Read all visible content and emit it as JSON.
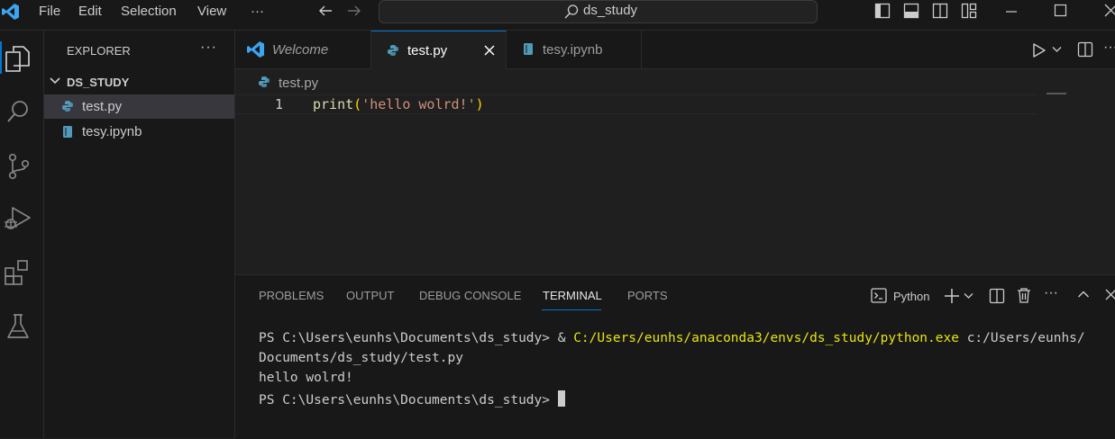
{
  "menu": [
    "File",
    "Edit",
    "Selection",
    "View",
    "···"
  ],
  "command_center": {
    "text": "ds_study"
  },
  "sidebar": {
    "title": "EXPLORER",
    "folder": "DS_STUDY",
    "files": [
      {
        "name": "test.py"
      },
      {
        "name": "tesy.ipynb"
      }
    ]
  },
  "tabs": [
    {
      "label": "Welcome"
    },
    {
      "label": "test.py"
    },
    {
      "label": "tesy.ipynb"
    }
  ],
  "breadcrumb": "test.py",
  "editor": {
    "line_number": "1",
    "code_fn": "print",
    "code_open": "(",
    "code_str": "'hello wolrd!'",
    "code_close": ")"
  },
  "panel": {
    "tabs": [
      "PROBLEMS",
      "OUTPUT",
      "DEBUG CONSOLE",
      "TERMINAL",
      "PORTS"
    ],
    "shell": "Python",
    "lines": {
      "prompt1": "PS C:\\Users\\eunhs\\Documents\\ds_study> ",
      "amp": "& ",
      "exe": "C:/Users/eunhs/anaconda3/envs/ds_study/python.exe",
      "arg": " c:/Users/eunhs/",
      "line2": "Documents/ds_study/test.py",
      "line3": "hello wolrd!",
      "prompt2": "PS C:\\Users\\eunhs\\Documents\\ds_study> "
    }
  },
  "colors": {
    "accent": "#0078d4",
    "string": "#ce9178",
    "function": "#dcdcaa",
    "exe": "#e5e510"
  }
}
